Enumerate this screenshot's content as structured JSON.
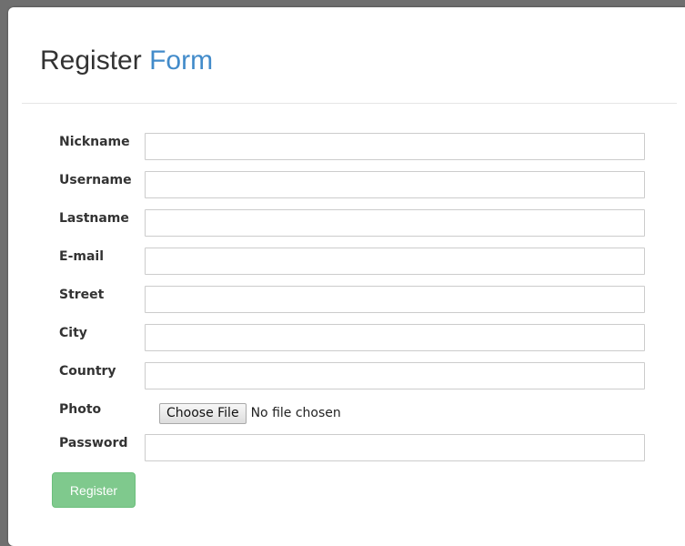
{
  "header": {
    "title_main": "Register",
    "title_accent": "Form"
  },
  "form": {
    "fields": [
      {
        "label": "Nickname",
        "value": ""
      },
      {
        "label": "Username",
        "value": ""
      },
      {
        "label": "Lastname",
        "value": ""
      },
      {
        "label": "E-mail",
        "value": ""
      },
      {
        "label": "Street",
        "value": ""
      },
      {
        "label": "City",
        "value": ""
      },
      {
        "label": "Country",
        "value": ""
      }
    ],
    "photo": {
      "label": "Photo",
      "button_label": "Choose File",
      "status": "No file chosen"
    },
    "password": {
      "label": "Password",
      "value": ""
    },
    "submit_label": "Register"
  },
  "colors": {
    "accent": "#428bca",
    "submit": "#7fc98d"
  }
}
